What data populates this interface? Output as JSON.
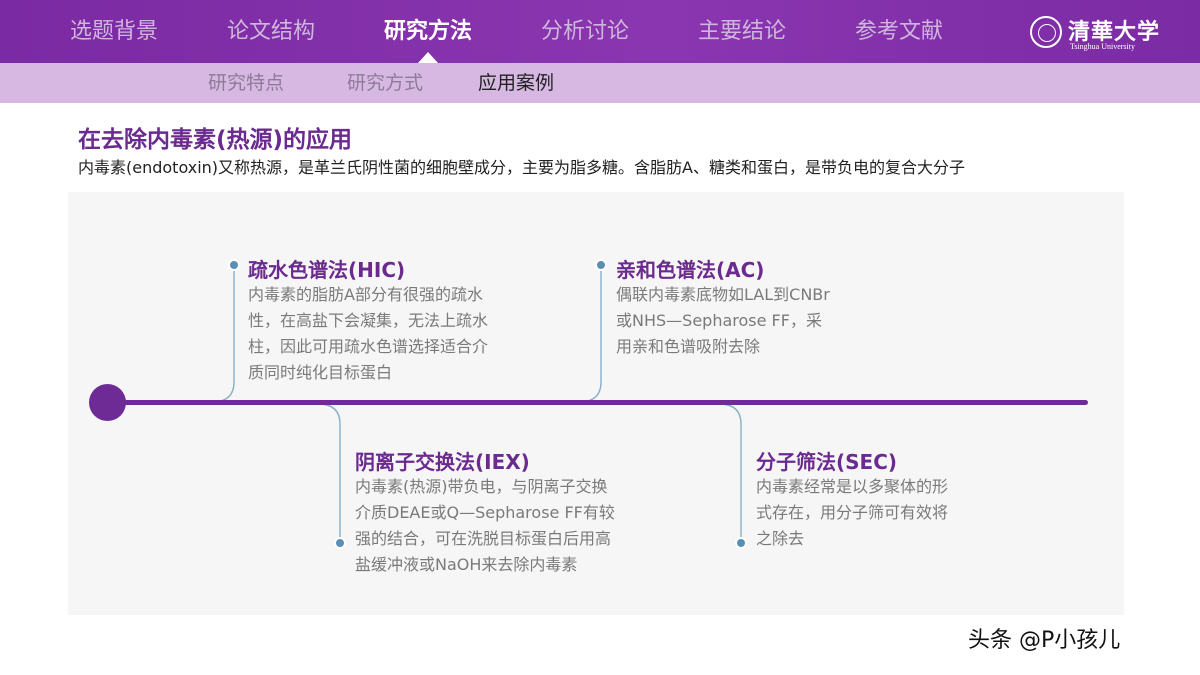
{
  "nav": {
    "tabs": [
      {
        "label": "选题背景"
      },
      {
        "label": "论文结构"
      },
      {
        "label": "研究方法"
      },
      {
        "label": "分析讨论"
      },
      {
        "label": "主要结论"
      },
      {
        "label": "参考文献"
      }
    ],
    "active_index": 2,
    "logo": {
      "cn": "清華大学",
      "en": "Tsinghua University"
    }
  },
  "subnav": {
    "tabs": [
      {
        "label": "研究特点"
      },
      {
        "label": "研究方式"
      },
      {
        "label": "应用案例"
      }
    ],
    "active_index": 2
  },
  "main": {
    "title": "在去除内毒素(热源)的应用",
    "intro": "内毒素(endotoxin)又称热源，是革兰氏阴性菌的细胞壁成分，主要为脂多糖。含脂肪A、糖类和蛋白，是带负电的复合大分子",
    "methods": [
      {
        "title": "疏水色谱法(HIC)",
        "desc": "内毒素的脂肪A部分有很强的疏水\n性，在高盐下会凝集，无法上疏水\n柱，因此可用疏水色谱选择适合介\n质同时纯化目标蛋白"
      },
      {
        "title": "亲和色谱法(AC)",
        "desc": "偶联内毒素底物如LAL到CNBr\n或NHS—Sepharose  FF，采\n用亲和色谱吸附去除"
      },
      {
        "title": "阴离子交换法(IEX)",
        "desc": "内毒素(热源)带负电，与阴离子交换\n介质DEAE或Q—Sepharose  FF有较\n强的结合，可在洗脱目标蛋白后用高\n盐缓冲液或NaOH来去除内毒素"
      },
      {
        "title": "分子筛法(SEC)",
        "desc": "内毒素经常是以多聚体的形\n式存在，用分子筛可有效将\n之除去"
      }
    ]
  },
  "watermark": "头条 @P小孩儿",
  "colors": {
    "nav_bg": "#7a2aa2",
    "subnav_bg": "#d7b8e3",
    "accent": "#6b2a8f",
    "connector": "#8ab0c8"
  }
}
